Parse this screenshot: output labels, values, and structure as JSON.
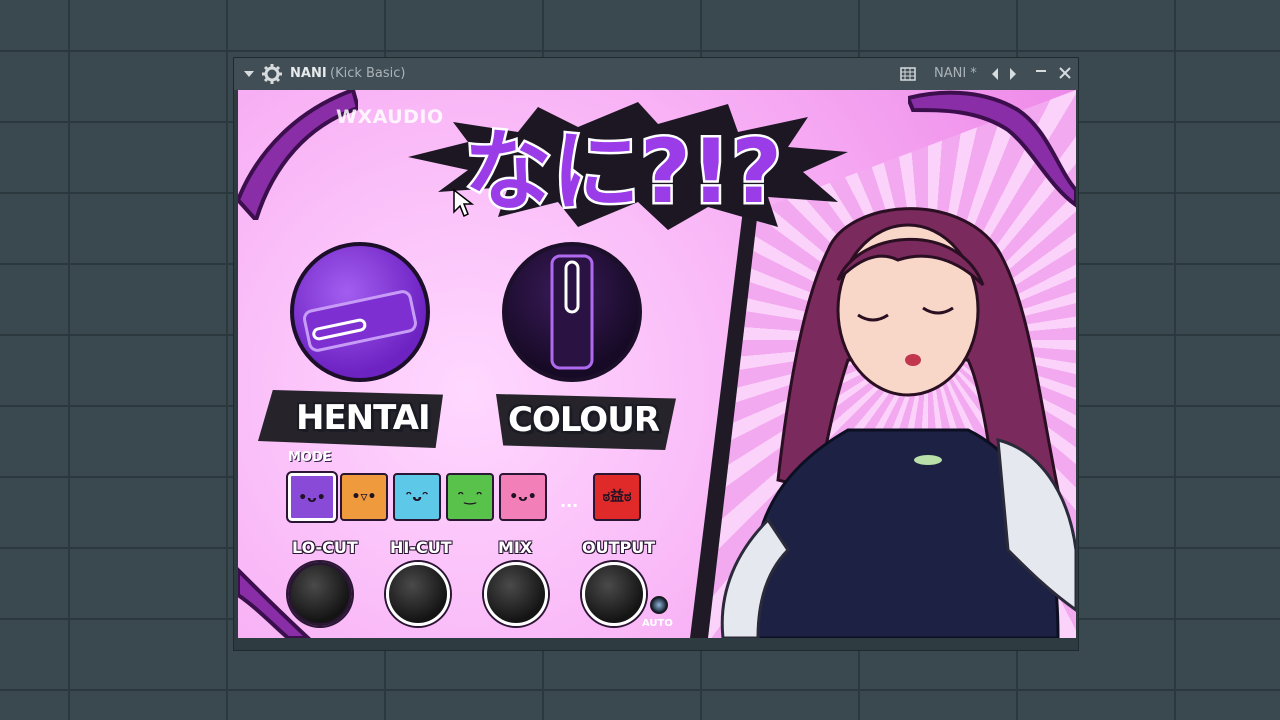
{
  "window": {
    "title": "NANI",
    "subtitle": "(Kick Basic)",
    "preset_name": "NANI *"
  },
  "plugin": {
    "brand": "WXAUDIO",
    "logo_text": "なに?!?",
    "knobs": {
      "hentai_label": "HENTAI",
      "colour_label": "COLOUR"
    },
    "mode": {
      "label": "MODE",
      "buttons": [
        {
          "face": "•ᴗ•",
          "color": "#8a4ad8",
          "selected": true
        },
        {
          "face": "•▿•",
          "color": "#f09a3e",
          "selected": false
        },
        {
          "face": "ᵔᴗᵔ",
          "color": "#5ec8e8",
          "selected": false
        },
        {
          "face": "ᵔ‿ᵔ",
          "color": "#58c24a",
          "selected": false
        },
        {
          "face": "•ᴗ•",
          "color": "#f27fb8",
          "selected": false
        },
        {
          "face": "ಠ益ಠ",
          "color": "#e02a2a",
          "selected": false
        }
      ],
      "more": "..."
    },
    "small_knobs": {
      "locut": "LO-CUT",
      "hicut": "HI-CUT",
      "mix": "MIX",
      "output": "OUTPUT"
    },
    "auto_label": "AUTO"
  },
  "colors": {
    "accent_purple": "#8a3cd8",
    "background_pink": "#f3a7f1",
    "titlebar": "#414e55"
  }
}
